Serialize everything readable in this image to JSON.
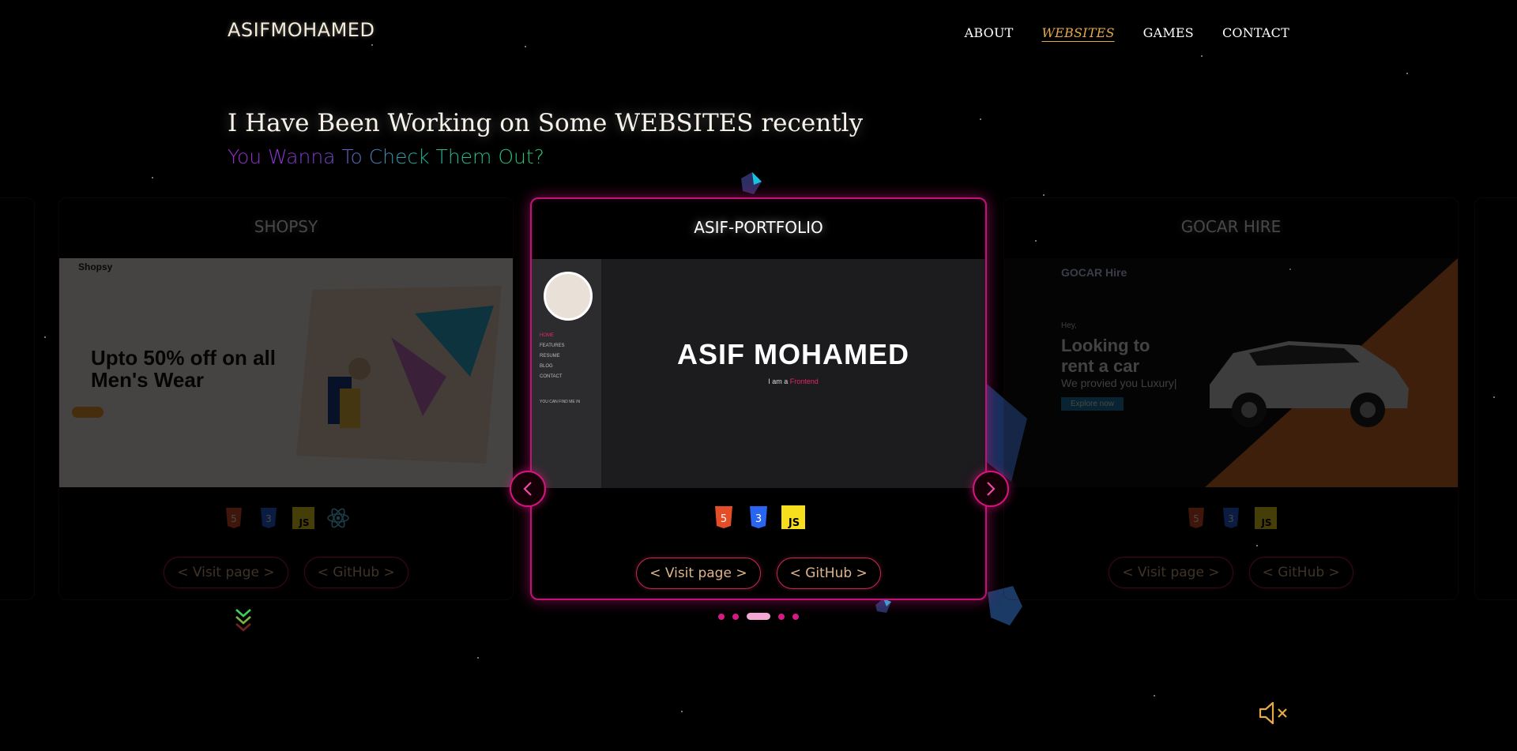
{
  "header": {
    "logo": "ASIFMOHAMED",
    "nav": [
      "ABOUT",
      "WEBSITES",
      "GAMES",
      "CONTACT"
    ],
    "active_nav": "WEBSITES"
  },
  "hero": {
    "headline": "I Have Been Working on Some WEBSITES recently",
    "subline": "You Wanna To Check Them Out?"
  },
  "projects": [
    {
      "title": "SHOPSY",
      "screenshot": {
        "brand": "Shopsy",
        "headline": "Upto 50% off on all Men's Wear"
      },
      "techs": [
        "html5-icon",
        "css3-icon",
        "js-icon",
        "react-icon"
      ],
      "visit_label": "< Visit page >",
      "github_label": "< GitHub >"
    },
    {
      "title": "ASIF-PORTFOLIO",
      "screenshot": {
        "name": "ASIF MOHAMED",
        "role_prefix": "I am a",
        "role": "Frontend",
        "menu": [
          "HOME",
          "FEATURES",
          "RESUME",
          "BLOG",
          "CONTACT"
        ],
        "find_me": "YOU CAN FIND ME IN"
      },
      "techs": [
        "html5-icon",
        "css3-icon",
        "js-icon"
      ],
      "visit_label": "< Visit page >",
      "github_label": "< GitHub >"
    },
    {
      "title": "GOCAR HIRE",
      "screenshot": {
        "brand": "GOCAR Hire",
        "greeting": "Hey,",
        "headline": "Looking to rent a car",
        "tagline": "We provied you Luxury|",
        "button": "Explore now"
      },
      "techs": [
        "html5-icon",
        "css3-icon",
        "js-icon"
      ],
      "visit_label": "< Visit page >",
      "github_label": "< GitHub >"
    }
  ],
  "carousel": {
    "total_slides": 5,
    "active_slide": 3
  },
  "colors": {
    "accent_pink": "#d61480",
    "nav_active": "#e6a94a",
    "button_text": "#e0b48a"
  }
}
